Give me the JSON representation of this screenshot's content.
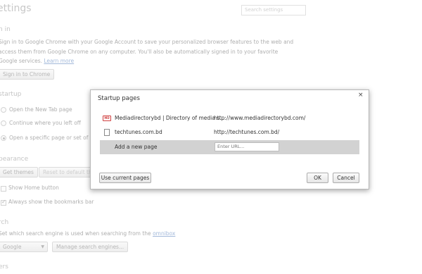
{
  "settings": {
    "title": "ettings",
    "search_placeholder": "Search settings",
    "signin": {
      "heading": "n in",
      "line1": "Sign in to Google Chrome with your Google Account to save your personalized browser features to the web and",
      "line2": "access them from Google Chrome on any computer. You'll also be automatically signed in to your favorite",
      "line3": "Google services.",
      "learn_more": "Learn more",
      "button": "Sign in to Chrome"
    },
    "startup": {
      "heading": "startup",
      "options": [
        {
          "label": "Open the New Tab page",
          "selected": false
        },
        {
          "label": "Continue where you left off",
          "selected": false
        },
        {
          "label": "Open a specific page or set of pa",
          "selected": true
        }
      ]
    },
    "appearance": {
      "heading": "pearance",
      "get_themes": "Get themes",
      "reset_theme": "Reset to default theme",
      "show_home": "Show Home button",
      "show_bookmarks": "Always show the bookmarks bar"
    },
    "search": {
      "heading": "rch",
      "text": "Set which search engine is used when searching from the",
      "omnibox": "omnibox",
      "engine": "Google",
      "manage": "Manage search engines..."
    },
    "users_heading": "ers"
  },
  "dialog": {
    "title": "Startup pages",
    "close_glyph": "×",
    "pages": [
      {
        "name": "Mediadirectorybd | Directory of media s...",
        "url": "http://www.mediadirectorybd.com/",
        "icon": "mediadirectory-favicon"
      },
      {
        "name": "techtunes.com.bd",
        "url": "http://techtunes.com.bd/",
        "icon": "page-icon"
      }
    ],
    "add_label": "Add a new page",
    "add_placeholder": "Enter URL...",
    "use_current": "Use current pages",
    "ok": "OK",
    "cancel": "Cancel",
    "md_icon_text": "MD"
  }
}
